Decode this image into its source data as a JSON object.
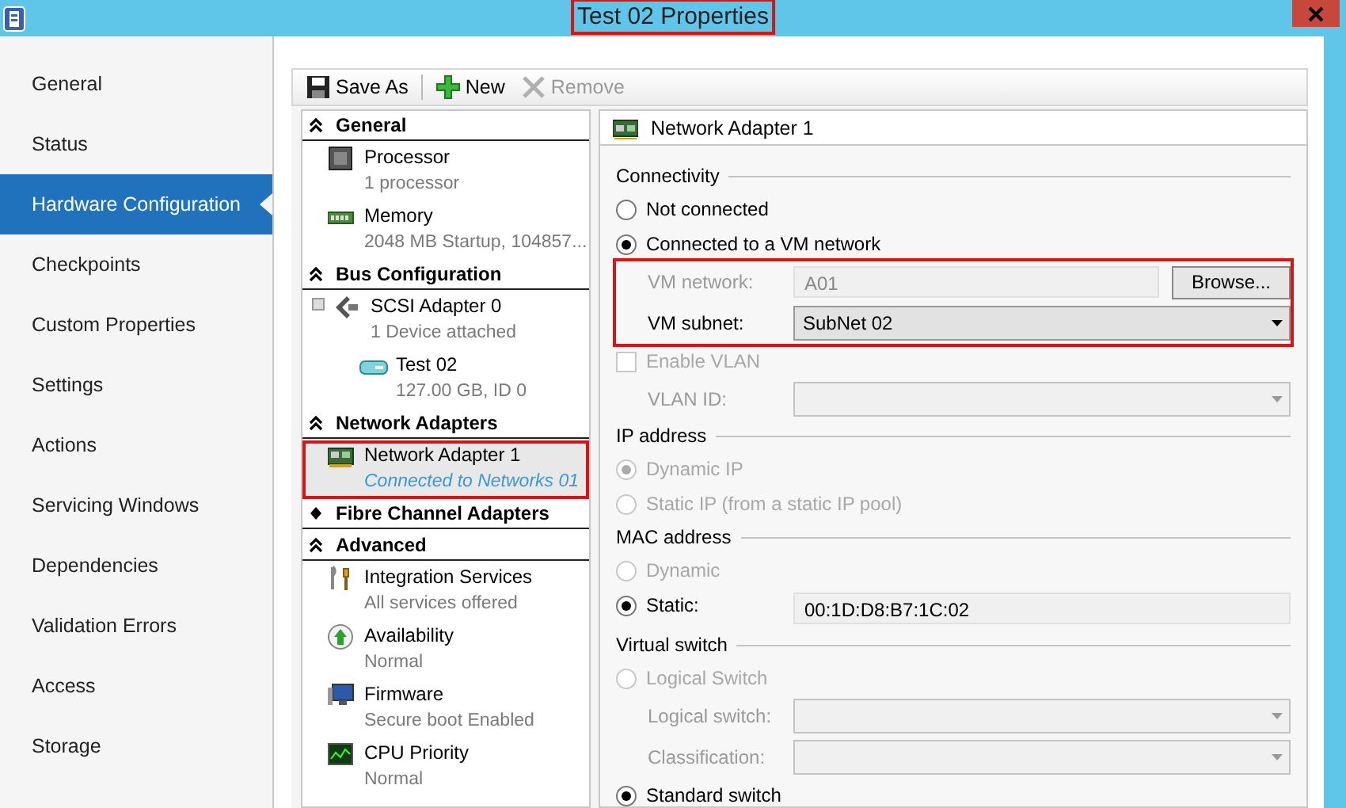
{
  "window": {
    "title": "Test 02 Properties",
    "title_annotated": true
  },
  "nav": {
    "items": [
      {
        "label": "General",
        "selected": false
      },
      {
        "label": "Status",
        "selected": false
      },
      {
        "label": "Hardware Configuration",
        "selected": true
      },
      {
        "label": "Checkpoints",
        "selected": false
      },
      {
        "label": "Custom Properties",
        "selected": false
      },
      {
        "label": "Settings",
        "selected": false
      },
      {
        "label": "Actions",
        "selected": false
      },
      {
        "label": "Servicing Windows",
        "selected": false
      },
      {
        "label": "Dependencies",
        "selected": false
      },
      {
        "label": "Validation Errors",
        "selected": false
      },
      {
        "label": "Access",
        "selected": false
      },
      {
        "label": "Storage",
        "selected": false
      }
    ]
  },
  "toolbar": [
    {
      "kind": "save",
      "label": "Save As",
      "disabled": false
    },
    {
      "kind": "new",
      "label": "New",
      "disabled": false
    },
    {
      "kind": "remove",
      "label": "Remove",
      "disabled": true
    }
  ],
  "tree": [
    {
      "title": "General",
      "expanded": true,
      "items": [
        {
          "kind": "processor",
          "name": "Processor",
          "detail": "1 processor",
          "selected": false,
          "annotated": false
        },
        {
          "kind": "memory",
          "name": "Memory",
          "detail": "2048 MB Startup, 104857...",
          "selected": false,
          "annotated": false
        }
      ]
    },
    {
      "title": "Bus Configuration",
      "expanded": true,
      "items": [
        {
          "kind": "scsi",
          "name": "SCSI Adapter 0",
          "detail": "1 Device attached",
          "selected": false,
          "annotated": false,
          "children": [
            {
              "kind": "disk",
              "name": "Test 02",
              "detail": "127.00 GB, ID 0",
              "selected": false,
              "annotated": false
            }
          ]
        }
      ]
    },
    {
      "title": "Network Adapters",
      "expanded": true,
      "items": [
        {
          "kind": "nic",
          "name": "Network Adapter 1",
          "detail": "Connected to Networks 01",
          "selected": true,
          "annotated": true
        }
      ]
    },
    {
      "title": "Fibre Channel Adapters",
      "expanded": false
    },
    {
      "title": "Advanced",
      "expanded": true,
      "items": [
        {
          "kind": "wrench",
          "name": "Integration Services",
          "detail": "All services offered",
          "selected": false,
          "annotated": false
        },
        {
          "kind": "uparrow",
          "name": "Availability",
          "detail": "Normal",
          "selected": false,
          "annotated": false
        },
        {
          "kind": "monitor",
          "name": "Firmware",
          "detail": "Secure boot Enabled",
          "selected": false,
          "annotated": false
        },
        {
          "kind": "cpuchart",
          "name": "CPU Priority",
          "detail": "Normal",
          "selected": false,
          "annotated": false
        }
      ]
    }
  ],
  "details": {
    "title": "Network Adapter 1",
    "rows": [
      {
        "kind": "group",
        "label": "Connectivity"
      },
      {
        "kind": "radio",
        "label": "Not connected",
        "selected": false,
        "disabled": false
      },
      {
        "kind": "radio",
        "label": "Connected to a VM network",
        "selected": true,
        "disabled": false
      },
      {
        "kind": "field",
        "label": "VM network:",
        "value": "A01",
        "disabled": true,
        "button": "Browse...",
        "annotated": true
      },
      {
        "kind": "dropdown",
        "label": "VM subnet:",
        "value": "SubNet 02",
        "disabled": false,
        "annotated": true
      },
      {
        "kind": "checkbox",
        "label": "Enable VLAN",
        "checked": false,
        "disabled": true
      },
      {
        "kind": "dropdown",
        "label": "VLAN ID:",
        "disabled": true,
        "annotated": false
      },
      {
        "kind": "group",
        "label": "IP address"
      },
      {
        "kind": "radio",
        "label": "Dynamic IP",
        "selected": true,
        "disabled": true
      },
      {
        "kind": "radio",
        "label": "Static IP (from a static IP pool)",
        "selected": false,
        "disabled": true
      },
      {
        "kind": "group",
        "label": "MAC address"
      },
      {
        "kind": "radio",
        "label": "Dynamic",
        "selected": false,
        "disabled": true
      },
      {
        "kind": "radio_field",
        "label": "Static:",
        "selected": true,
        "disabled": false,
        "value": "00:1D:D8:B7:1C:02"
      },
      {
        "kind": "group",
        "label": "Virtual switch"
      },
      {
        "kind": "radio",
        "label": "Logical Switch",
        "selected": false,
        "disabled": true
      },
      {
        "kind": "dropdown",
        "label": "Logical switch:",
        "disabled": true,
        "annotated": false
      },
      {
        "kind": "dropdown",
        "label": "Classification:",
        "disabled": true,
        "annotated": false
      },
      {
        "kind": "radio",
        "label": "Standard switch",
        "selected": true,
        "disabled": false
      }
    ]
  }
}
